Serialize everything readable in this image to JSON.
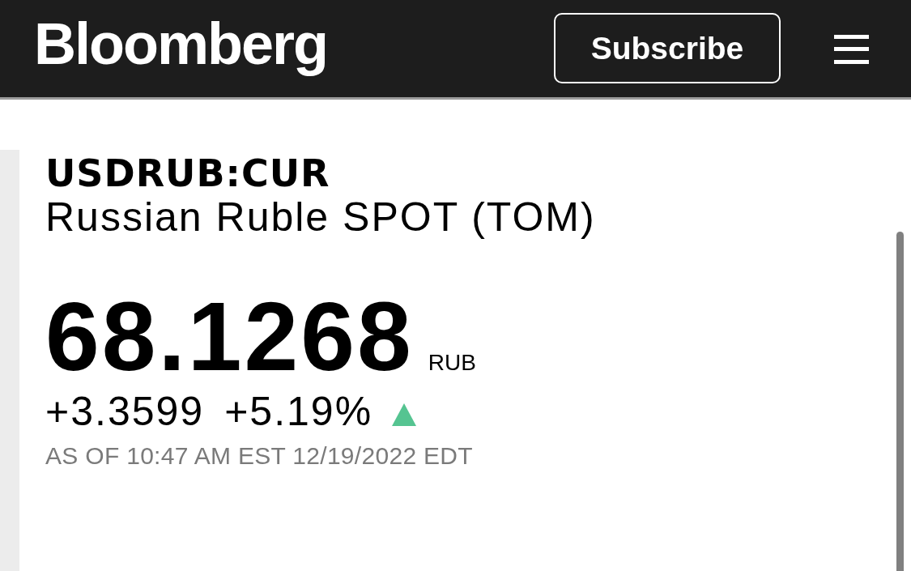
{
  "header": {
    "logo": "Bloomberg",
    "subscribe_button": "Subscribe"
  },
  "quote": {
    "ticker": "USDRUB:CUR",
    "name": "Russian Ruble SPOT (TOM)",
    "price": "68.1268",
    "currency": "RUB",
    "change": "+3.3599",
    "change_percent": "+5.19%",
    "up": true,
    "timestamp": "AS OF 10:47 AM EST 12/19/2022 EDT"
  }
}
